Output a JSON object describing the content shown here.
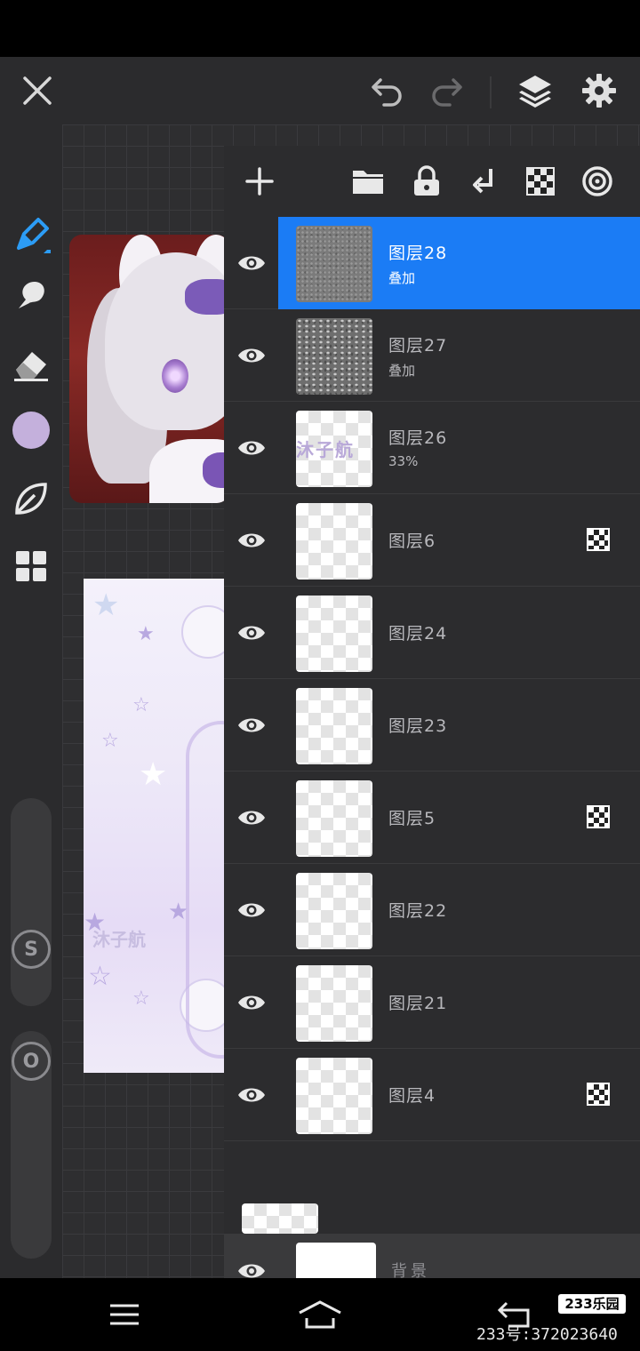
{
  "colors": {
    "accent": "#1b7cf5",
    "panel_bg": "#2c2c2e",
    "current_color": "#c4b0dc"
  },
  "top_bar": {
    "icons": [
      "close-icon",
      "undo-icon",
      "redo-icon",
      "layers-icon",
      "settings-icon"
    ]
  },
  "left_toolbar": {
    "tools": [
      "brush-icon",
      "smudge-icon",
      "eraser-icon",
      "color-swatch",
      "leaf-icon",
      "grid-icon"
    ],
    "size_slider_label": "S",
    "opacity_slider_label": "O"
  },
  "layers_panel": {
    "toolbar_icons": [
      "add-icon",
      "folder-icon",
      "lock-icon",
      "merge-down-icon",
      "clipping-icon",
      "mask-icon"
    ],
    "layers": [
      {
        "name": "图层28",
        "sub": "叠加",
        "selected": true,
        "clip": false,
        "thumb": "noise"
      },
      {
        "name": "图层27",
        "sub": "叠加",
        "selected": false,
        "clip": false,
        "thumb": "noise2"
      },
      {
        "name": "图层26",
        "sub": "33%",
        "selected": false,
        "clip": false,
        "thumb": "text",
        "thumb_text": "沐子航"
      },
      {
        "name": "图层6",
        "sub": "",
        "selected": false,
        "clip": true,
        "thumb": "transparent"
      },
      {
        "name": "图层24",
        "sub": "",
        "selected": false,
        "clip": false,
        "thumb": "transparent"
      },
      {
        "name": "图层23",
        "sub": "",
        "selected": false,
        "clip": false,
        "thumb": "transparent"
      },
      {
        "name": "图层5",
        "sub": "",
        "selected": false,
        "clip": true,
        "thumb": "transparent"
      },
      {
        "name": "图层22",
        "sub": "",
        "selected": false,
        "clip": false,
        "thumb": "transparent"
      },
      {
        "name": "图层21",
        "sub": "",
        "selected": false,
        "clip": false,
        "thumb": "transparent"
      },
      {
        "name": "图层4",
        "sub": "",
        "selected": false,
        "clip": true,
        "thumb": "transparent"
      }
    ],
    "background_layer": {
      "name": "背景"
    }
  },
  "nav": {
    "icons": [
      "menu-icon",
      "home-icon",
      "back-icon"
    ]
  },
  "watermark": {
    "logo": "233乐园",
    "id_text": "233号:372023640"
  }
}
